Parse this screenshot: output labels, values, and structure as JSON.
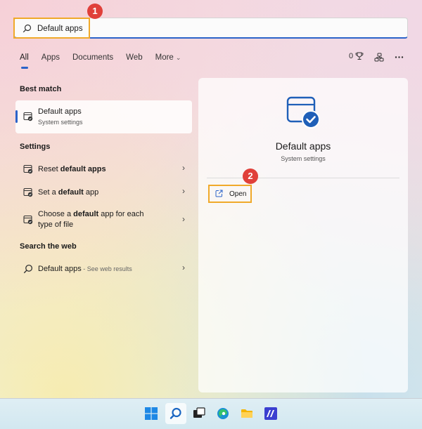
{
  "search": {
    "value": "Default apps",
    "placeholder": ""
  },
  "badges": {
    "one": "1",
    "two": "2"
  },
  "tabs": [
    {
      "label": "All"
    },
    {
      "label": "Apps"
    },
    {
      "label": "Documents"
    },
    {
      "label": "Web"
    },
    {
      "label": "More"
    }
  ],
  "toolbar": {
    "points": "0"
  },
  "best_match": {
    "heading": "Best match",
    "title": "Default apps",
    "subtitle": "System settings"
  },
  "settings": {
    "heading": "Settings",
    "items": [
      {
        "pre": "Reset ",
        "bold": "default apps",
        "post": ""
      },
      {
        "pre": "Set a ",
        "bold": "default",
        "post": " app"
      },
      {
        "pre": "Choose a ",
        "bold": "default",
        "post": " app for each",
        "line2": "type of file"
      }
    ]
  },
  "web": {
    "heading": "Search the web",
    "query": "Default apps",
    "hint": " - See web results"
  },
  "preview": {
    "title": "Default apps",
    "subtitle": "System settings",
    "open_label": "Open"
  },
  "icons": {
    "search": "search-icon",
    "settings_item": "default-apps-settings-icon",
    "open": "open-external-icon",
    "more": "more-options-icon"
  },
  "colors": {
    "accent": "#2b63c9",
    "highlight": "#f0a92a",
    "badge": "#e0403a"
  }
}
